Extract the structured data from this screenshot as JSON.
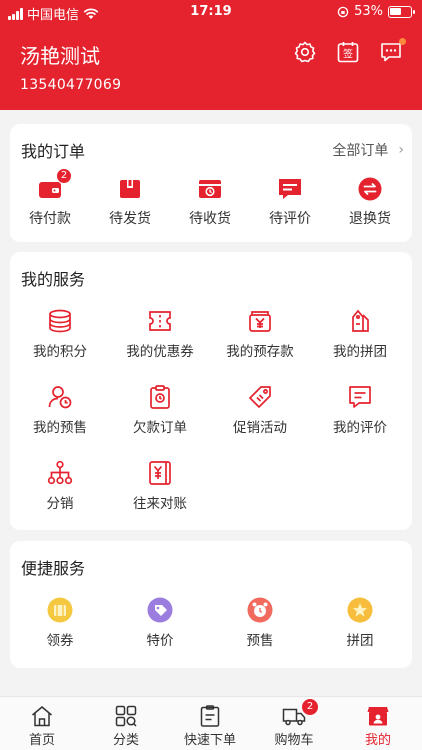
{
  "status_bar": {
    "carrier": "中国电信",
    "time": "17:19",
    "battery": "53%"
  },
  "header": {
    "user_name": "汤艳测试",
    "phone": "13540477069",
    "sign_icon_text": "签"
  },
  "orders": {
    "title": "我的订单",
    "all_orders": "全部订单",
    "items": [
      {
        "label": "待付款",
        "icon": "wallet-icon",
        "badge": "2"
      },
      {
        "label": "待发货",
        "icon": "package-icon"
      },
      {
        "label": "待收货",
        "icon": "truck-box-icon"
      },
      {
        "label": "待评价",
        "icon": "comment-icon"
      },
      {
        "label": "退换货",
        "icon": "exchange-icon"
      }
    ]
  },
  "services": {
    "title": "我的服务",
    "items": [
      {
        "label": "我的积分",
        "icon": "coins-icon"
      },
      {
        "label": "我的优惠券",
        "icon": "ticket-icon"
      },
      {
        "label": "我的预存款",
        "icon": "deposit-icon"
      },
      {
        "label": "我的拼团",
        "icon": "group-tag-icon"
      },
      {
        "label": "我的预售",
        "icon": "user-clock-icon"
      },
      {
        "label": "欠款订单",
        "icon": "clipboard-icon"
      },
      {
        "label": "促销活动",
        "icon": "price-tag-icon"
      },
      {
        "label": "我的评价",
        "icon": "message-lines-icon"
      },
      {
        "label": "分销",
        "icon": "hierarchy-icon"
      },
      {
        "label": "往来对账",
        "icon": "ledger-icon"
      }
    ]
  },
  "quick": {
    "title": "便捷服务",
    "items": [
      {
        "label": "领券",
        "icon": "coupon-icon",
        "color": "#f5c842"
      },
      {
        "label": "特价",
        "icon": "special-price-icon",
        "color": "#9b7de0"
      },
      {
        "label": "预售",
        "icon": "alarm-clock-icon",
        "color": "#f26a5e"
      },
      {
        "label": "拼团",
        "icon": "group-buy-icon",
        "color": "#f7bd3c"
      }
    ]
  },
  "tabbar": {
    "items": [
      {
        "label": "首页",
        "icon": "home-icon"
      },
      {
        "label": "分类",
        "icon": "category-icon"
      },
      {
        "label": "快速下单",
        "icon": "quick-order-icon"
      },
      {
        "label": "购物车",
        "icon": "cart-truck-icon",
        "badge": "2"
      },
      {
        "label": "我的",
        "icon": "profile-icon",
        "active": true
      }
    ]
  },
  "colors": {
    "brand": "#e5232f",
    "background": "#f3f3f3"
  }
}
